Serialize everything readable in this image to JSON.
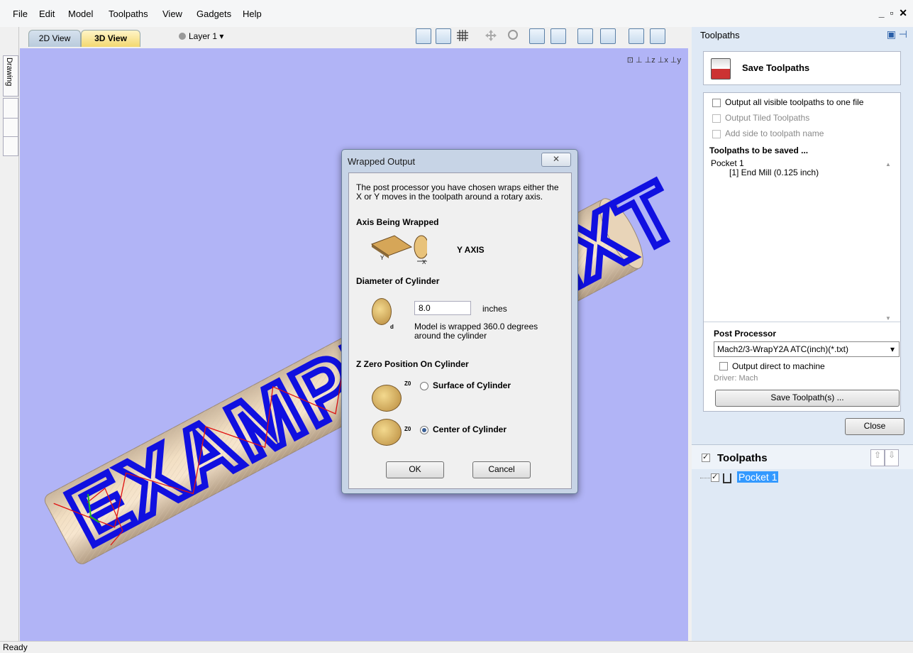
{
  "menu": [
    "File",
    "Edit",
    "Model",
    "Toolpaths",
    "View",
    "Gadgets",
    "Help"
  ],
  "window_controls": "_ ▫ ✕",
  "left_tab": "Drawing",
  "view_tabs": {
    "tab_2d": "2D View",
    "tab_3d": "3D View"
  },
  "layer": "Layer 1 ▾",
  "model_text": "EXAMPLE TEXT",
  "dialog": {
    "title": "Wrapped Output",
    "close": "✕",
    "intro": "The post processor you have chosen wraps either the X or Y moves in the toolpath around a rotary axis.",
    "axis_heading": "Axis Being Wrapped",
    "axis_value": "Y AXIS",
    "axis_icon_labels": {
      "y": "Y",
      "x": "X"
    },
    "diameter_heading": "Diameter of Cylinder",
    "diameter_value": "8.0",
    "diameter_unit": "inches",
    "diameter_icon_label": "d",
    "wrap_note": "Model is wrapped 360.0 degrees around the cylinder",
    "zzero_heading": "Z Zero Position On Cylinder",
    "z0_label": "Z0",
    "option_surface": "Surface of Cylinder",
    "option_center": "Center of Cylinder",
    "selected_option": "center",
    "ok": "OK",
    "cancel": "Cancel"
  },
  "right_panel": {
    "title": "Toolpaths",
    "save_header": "Save Toolpaths",
    "chk_output_all": "Output all visible toolpaths to one file",
    "chk_tiled": "Output Tiled Toolpaths",
    "chk_side": "Add side to toolpath name",
    "to_save_heading": "Toolpaths to be saved ...",
    "to_save_items": [
      "Pocket 1",
      "[1] End Mill (0.125 inch)"
    ],
    "post_processor_heading": "Post Processor",
    "post_processor_value": "Mach2/3-WrapY2A ATC(inch)(*.txt)",
    "chk_direct": "Output direct to machine",
    "driver": "Driver: Mach",
    "save_button": "Save Toolpath(s) ...",
    "close_button": "Close",
    "tree_header": "Toolpaths",
    "tree_item": "Pocket 1"
  },
  "status": "Ready",
  "colors": {
    "viewport_bg": "#b1b4f6",
    "model_text": "#1010e0",
    "toolpath": "#e01010",
    "selection": "#3399ff"
  }
}
